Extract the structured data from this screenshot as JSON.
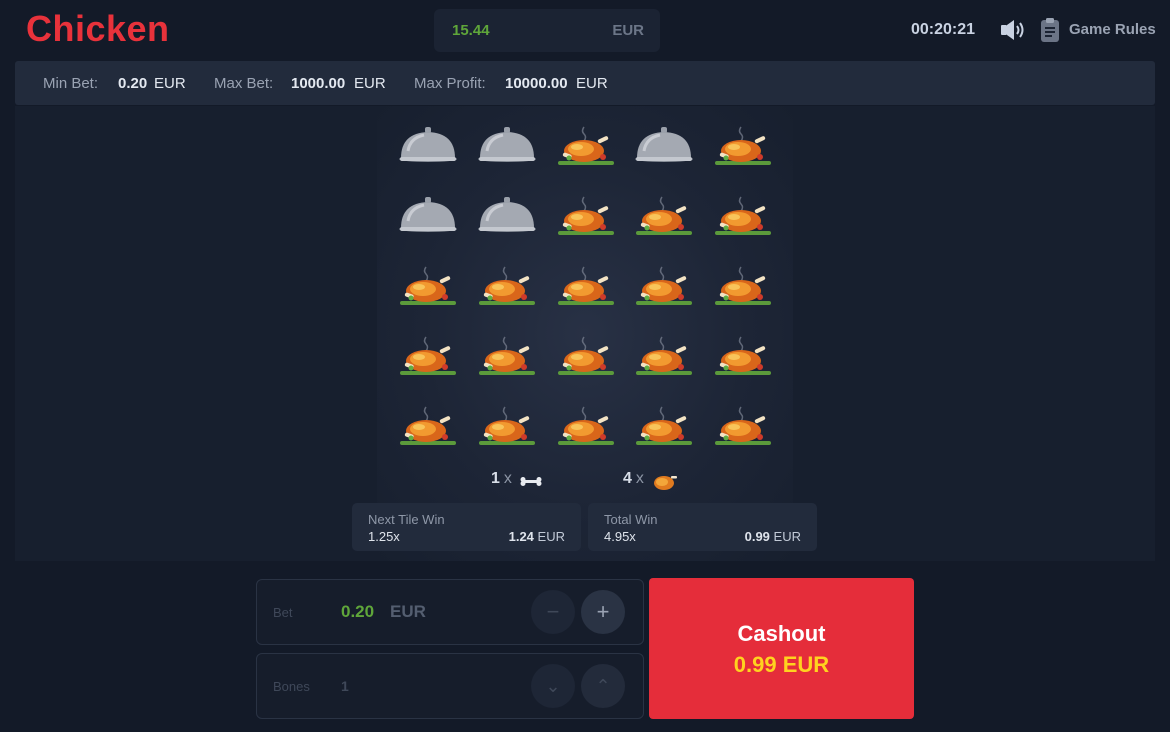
{
  "header": {
    "logo": "Chicken",
    "balance": "15.44",
    "balance_currency": "EUR",
    "timer": "00:20:21",
    "game_rules": "Game Rules"
  },
  "limits": {
    "min_bet_label": "Min Bet:",
    "min_bet_value": "0.20",
    "max_bet_label": "Max Bet:",
    "max_bet_value": "1000.00",
    "max_profit_label": "Max Profit:",
    "max_profit_value": "10000.00",
    "currency": "EUR"
  },
  "board": {
    "rows": [
      [
        "cloche",
        "cloche",
        "chicken",
        "cloche",
        "chicken"
      ],
      [
        "cloche",
        "cloche",
        "chicken",
        "chicken",
        "chicken"
      ],
      [
        "chicken",
        "chicken",
        "chicken",
        "chicken",
        "chicken"
      ],
      [
        "chicken",
        "chicken",
        "chicken",
        "chicken",
        "chicken"
      ],
      [
        "chicken",
        "chicken",
        "chicken",
        "chicken",
        "chicken"
      ]
    ],
    "bones_count": "1",
    "chickens_count": "4",
    "x": "x"
  },
  "next_tile": {
    "title": "Next Tile Win",
    "multiplier": "1.25x",
    "amount": "1.24",
    "currency": "EUR"
  },
  "total_win": {
    "title": "Total Win",
    "multiplier": "4.95x",
    "amount": "0.99",
    "currency": "EUR"
  },
  "bet": {
    "label": "Bet",
    "value": "0.20",
    "currency": "EUR",
    "minus": "−",
    "plus": "+"
  },
  "bones": {
    "label": "Bones",
    "value": "1",
    "down": "⌄",
    "up": "⌃"
  },
  "cashout": {
    "label": "Cashout",
    "amount": "0.99",
    "currency": "EUR"
  }
}
